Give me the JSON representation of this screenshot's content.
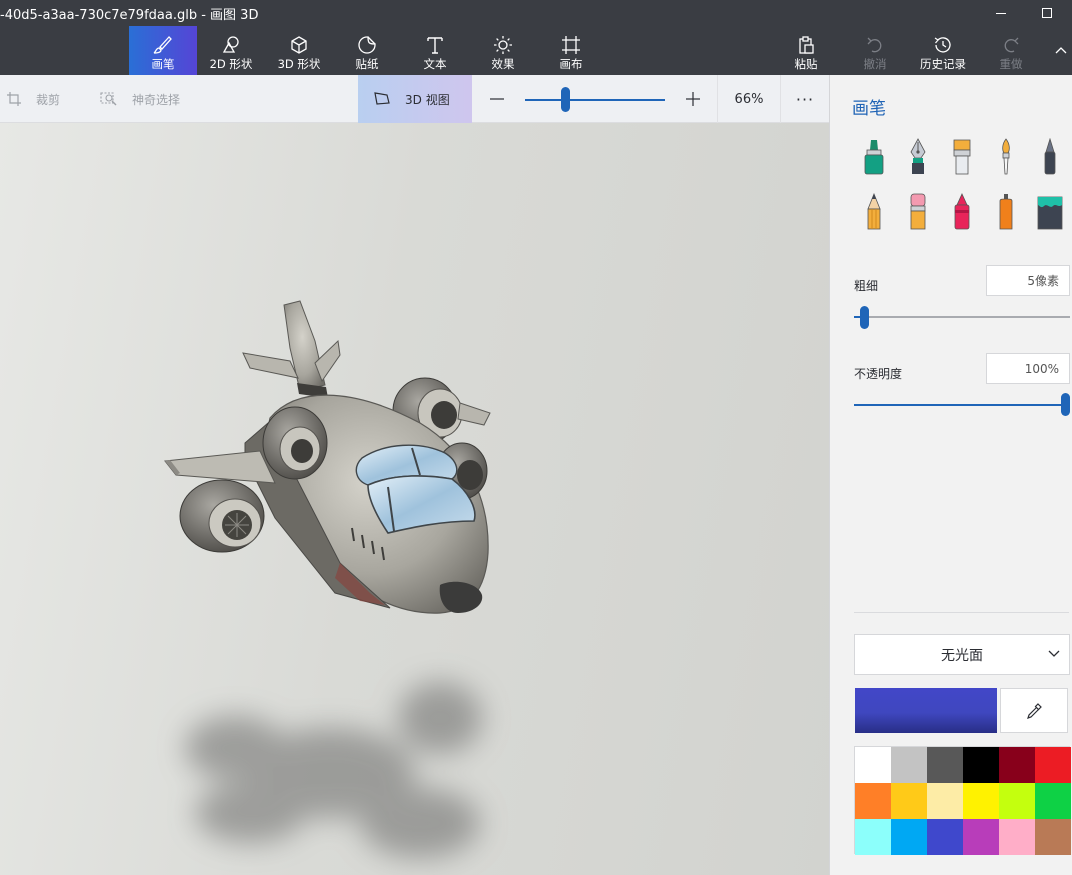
{
  "window": {
    "title": "-40d5-a3aa-730c7e79fdaa.glb - 画图 3D",
    "buttons": {
      "minimize": "minimize-icon",
      "maximize": "maximize-icon"
    }
  },
  "ribbon": {
    "tools": [
      {
        "label": "画笔",
        "icon": "brush-icon",
        "active": true
      },
      {
        "label": "2D 形状",
        "icon": "shapes-2d-icon"
      },
      {
        "label": "3D 形状",
        "icon": "cube-icon"
      },
      {
        "label": "贴纸",
        "icon": "sticker-icon"
      },
      {
        "label": "文本",
        "icon": "text-icon"
      },
      {
        "label": "效果",
        "icon": "sun-icon"
      },
      {
        "label": "画布",
        "icon": "canvas-icon"
      }
    ],
    "actions": [
      {
        "label": "粘贴",
        "icon": "paste-icon",
        "enabled": true
      },
      {
        "label": "撤消",
        "icon": "undo-icon",
        "enabled": false
      },
      {
        "label": "历史记录",
        "icon": "history-icon",
        "enabled": true
      },
      {
        "label": "重做",
        "icon": "redo-icon",
        "enabled": false
      }
    ],
    "collapse_icon": "chevron-up-icon"
  },
  "subbar": {
    "crop_label": "裁剪",
    "magic_select_label": "神奇选择",
    "view3d_label": "3D 视图",
    "zoom_value": "66%",
    "zoom_fraction": 0.29,
    "more_label": "···"
  },
  "panel": {
    "title": "画笔",
    "brushes": [
      "marker-icon",
      "calligraphy-pen-icon",
      "oil-brush-icon",
      "watercolor-icon",
      "pixel-pen-icon",
      "pencil-icon",
      "eraser-icon",
      "crayon-icon",
      "spray-can-icon",
      "fill-bucket-icon"
    ],
    "thickness": {
      "label": "粗细",
      "value": "5像素",
      "fraction": 0.05
    },
    "opacity": {
      "label": "不透明度",
      "value": "100%",
      "fraction": 1.0
    },
    "finish": {
      "value": "无光面"
    },
    "current_color": "#4247c8",
    "palette": [
      "#ffffff",
      "#c3c3c3",
      "#585858",
      "#000000",
      "#88001b",
      "#ec1c24",
      "#ff7f27",
      "#ffca18",
      "#fdeca6",
      "#fff200",
      "#c4ff0e",
      "#0ed145",
      "#8cfffb",
      "#00a8f3",
      "#3f48cc",
      "#b83dba",
      "#ffaec8",
      "#b97a56"
    ]
  },
  "colors": {
    "accent": "#1f65b8",
    "titlebar": "#3a3d43"
  }
}
